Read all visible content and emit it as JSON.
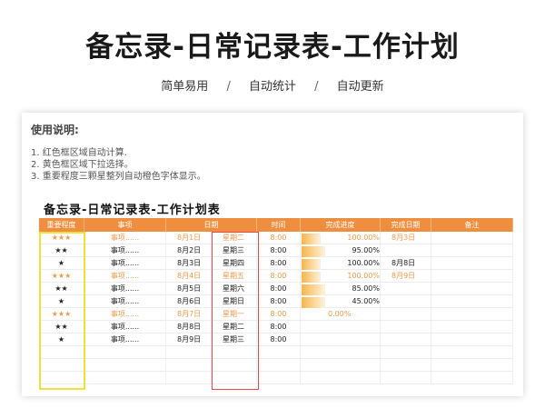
{
  "page": {
    "title": "备忘录-日常记录表-工作计划",
    "tags": [
      "简单易用",
      "自动统计",
      "自动更新"
    ],
    "separator": "/"
  },
  "usage": {
    "title": "使用说明:",
    "items": [
      "1. 红色框区域自动计算.",
      "2. 黄色框区域下拉选择。",
      "3. 重要程度三颗星整列自动橙色字体显示。"
    ]
  },
  "sheet": {
    "title": "备忘录-日常记录表-工作计划表",
    "headers": [
      "重要程度",
      "事项",
      "日期",
      "",
      "时间",
      "完成进度",
      "完成日期",
      "备注"
    ],
    "rows": [
      {
        "stars": "★★★",
        "item": "事项......",
        "date": "8月1日",
        "weekday": "星期二",
        "time": "8:00",
        "progress": "100.00%",
        "progress_value": 1.0,
        "done": "8月3日",
        "note": "",
        "highlight": true
      },
      {
        "stars": "★★",
        "item": "事项......",
        "date": "8月2日",
        "weekday": "星期三",
        "time": "8:00",
        "progress": "95.00%",
        "progress_value": 0.95,
        "done": "",
        "note": "",
        "highlight": false
      },
      {
        "stars": "★",
        "item": "事项......",
        "date": "8月3日",
        "weekday": "星期四",
        "time": "8:00",
        "progress": "100.00%",
        "progress_value": 1.0,
        "done": "8月8日",
        "note": "",
        "highlight": false
      },
      {
        "stars": "★★★",
        "item": "事项......",
        "date": "8月4日",
        "weekday": "星期五",
        "time": "8:00",
        "progress": "100.00%",
        "progress_value": 1.0,
        "done": "8月9日",
        "note": "",
        "highlight": true
      },
      {
        "stars": "★★",
        "item": "事项......",
        "date": "8月5日",
        "weekday": "星期六",
        "time": "8:00",
        "progress": "85.00%",
        "progress_value": 0.85,
        "done": "",
        "note": "",
        "highlight": false
      },
      {
        "stars": "★",
        "item": "事项......",
        "date": "8月6日",
        "weekday": "星期日",
        "time": "8:00",
        "progress": "45.00%",
        "progress_value": 0.45,
        "done": "",
        "note": "",
        "highlight": false
      },
      {
        "stars": "★★★",
        "item": "事项......",
        "date": "8月7日",
        "weekday": "星期一",
        "time": "8:00",
        "progress": "0.00%",
        "progress_value": 0.0,
        "done": "",
        "note": "",
        "highlight": true
      },
      {
        "stars": "★★",
        "item": "事项......",
        "date": "8月8日",
        "weekday": "星期二",
        "time": "8:00",
        "progress": "",
        "progress_value": 0.0,
        "done": "",
        "note": "",
        "highlight": false
      },
      {
        "stars": "★",
        "item": "事项......",
        "date": "8月9日",
        "weekday": "星期三",
        "time": "8:00",
        "progress": "",
        "progress_value": 0.0,
        "done": "",
        "note": "",
        "highlight": false
      },
      {
        "stars": "",
        "item": "",
        "date": "",
        "weekday": "",
        "time": "",
        "progress": "",
        "progress_value": 0.0,
        "done": "",
        "note": "",
        "highlight": false
      },
      {
        "stars": "",
        "item": "",
        "date": "",
        "weekday": "",
        "time": "",
        "progress": "",
        "progress_value": 0.0,
        "done": "",
        "note": "",
        "highlight": false
      },
      {
        "stars": "",
        "item": "",
        "date": "",
        "weekday": "",
        "time": "",
        "progress": "",
        "progress_value": 0.0,
        "done": "",
        "note": "",
        "highlight": false
      }
    ]
  },
  "colors": {
    "header_bg": "#f08e3f",
    "highlight_text": "#ee9a4d",
    "yellow_frame": "#f2e03a",
    "red_frame": "#e24a4a",
    "progress_bar": "#f7b44a"
  }
}
